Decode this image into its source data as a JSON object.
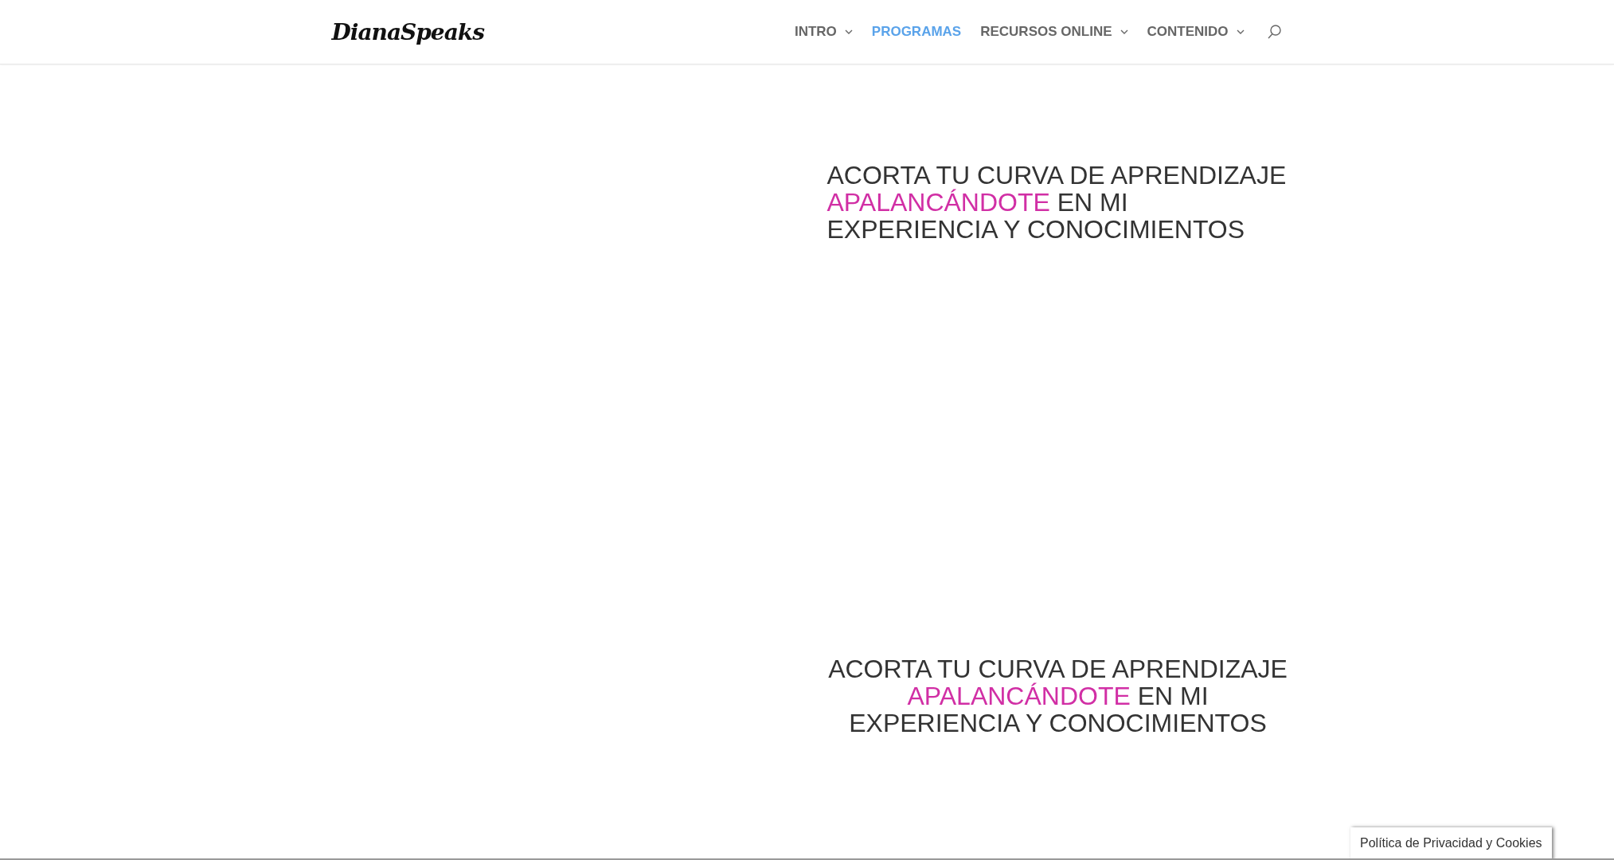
{
  "header": {
    "logo": "DianaSpeaks",
    "nav": [
      {
        "label": "INTRO",
        "selected": false,
        "has_submenu": true
      },
      {
        "label": "PROGRAMAS",
        "selected": true,
        "has_submenu": false
      },
      {
        "label": "RECURSOS ONLINE",
        "selected": false,
        "has_submenu": true
      },
      {
        "label": "CONTENIDO",
        "selected": false,
        "has_submenu": true
      }
    ]
  },
  "sections": [
    {
      "kind": "left",
      "line_1": "ACORTA TU CURVA DE APRENDIZAJE",
      "highlight": "APALANCÁNDOTE",
      "line_2_rest": "EN MI",
      "line_3": "EXPERIENCIA Y CONOCIMIENTOS"
    },
    {
      "kind": "centered",
      "line_1": "ACORTA TU CURVA DE APRENDIZAJE",
      "highlight": "APALANCÁNDOTE",
      "line_2_rest": "EN MI",
      "line_3": "EXPERIENCIA Y CONOCIMIENTOS"
    }
  ],
  "cookie_badge": "Política de Privacidad y Cookies"
}
